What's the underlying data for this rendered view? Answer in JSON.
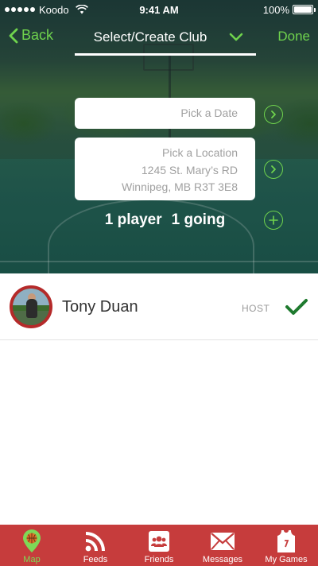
{
  "status_bar": {
    "carrier": "Koodo",
    "time": "9:41 AM",
    "battery": "100%"
  },
  "nav": {
    "back_label": "Back",
    "title": "Select/Create Club",
    "done_label": "Done"
  },
  "form": {
    "date_placeholder": "Pick a Date",
    "location_placeholder": "Pick a Location",
    "location_line1": "1245 St. Mary’s RD",
    "location_line2": "Winnipeg, MB R3T 3E8",
    "players_count": "1 player",
    "going_count": "1 going"
  },
  "player": {
    "name": "Tony Duan",
    "badge": "HOST"
  },
  "tabs": [
    {
      "label": "Map",
      "icon": "map-pin-basketball-icon",
      "active": true
    },
    {
      "label": "Feeds",
      "icon": "rss-icon",
      "active": false
    },
    {
      "label": "Friends",
      "icon": "friends-icon",
      "active": false
    },
    {
      "label": "Messages",
      "icon": "envelope-icon",
      "active": false
    },
    {
      "label": "My Games",
      "icon": "jersey-icon",
      "active": false
    }
  ],
  "colors": {
    "accent": "#6fd34d",
    "tab_bar": "#c63c3c",
    "avatar_ring": "#b52a2a",
    "check": "#1e7a2e"
  }
}
